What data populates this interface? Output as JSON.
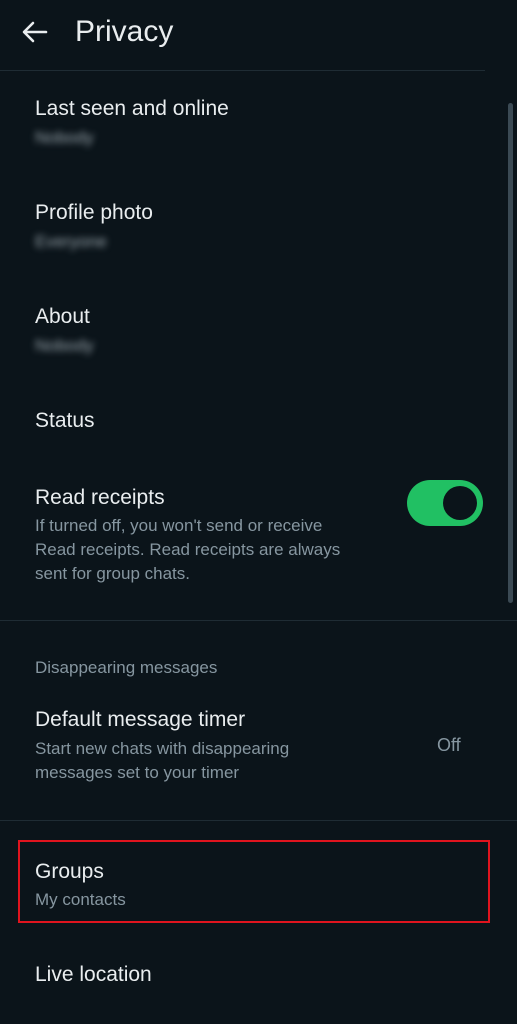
{
  "header": {
    "title": "Privacy",
    "back_icon": "arrow-left-icon"
  },
  "items": {
    "last_seen": {
      "title": "Last seen and online",
      "value": "Nobody"
    },
    "profile_photo": {
      "title": "Profile photo",
      "value": "Everyone"
    },
    "about": {
      "title": "About",
      "value": "Nobody"
    },
    "status": {
      "title": "Status"
    },
    "read_receipts": {
      "title": "Read receipts",
      "description_line1": "If turned off, you won't send or receive",
      "description_line2": "Read receipts. Read receipts are always",
      "description_line3": "sent for group chats.",
      "enabled": true
    },
    "disappearing_header": "Disappearing messages",
    "default_timer": {
      "title": "Default message timer",
      "description_line1": "Start new chats with disappearing",
      "description_line2": "messages set to your timer",
      "value": "Off"
    },
    "groups": {
      "title": "Groups",
      "value": "My contacts"
    },
    "live_location": {
      "title": "Live location"
    }
  },
  "colors": {
    "background": "#0b141a",
    "toggle_on": "#21c063",
    "highlight": "#e0141e",
    "secondary_text": "#8696a0"
  }
}
